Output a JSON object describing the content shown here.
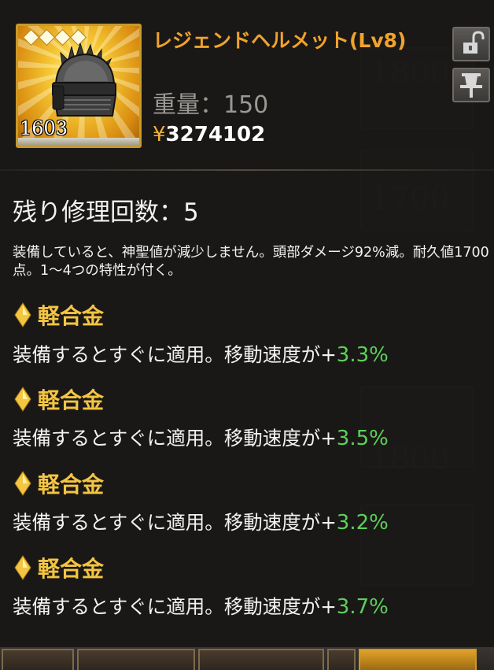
{
  "item": {
    "name": "レジェンドヘルメット(Lv8)",
    "count": "1603",
    "weight": "重量：150",
    "price_symbol": "¥",
    "price": "3274102",
    "stars": 4,
    "icon": "helmet-icon",
    "rarity_color": "#f0a32c"
  },
  "buttons": {
    "lock_icon": "unlock-icon",
    "pin_icon": "pin-icon"
  },
  "repair": {
    "label": "残り修理回数：5"
  },
  "description": "装備していると、神聖値が減少しません。頭部ダメージ92%減。耐久値1700点。1〜4つの特性が付く。",
  "traits": [
    {
      "name": "軽合金",
      "text": "装備するとすぐに適用。移動速度が+",
      "value": "3.3%"
    },
    {
      "name": "軽合金",
      "text": "装備するとすぐに適用。移動速度が+",
      "value": "3.5%"
    },
    {
      "name": "軽合金",
      "text": "装備するとすぐに適用。移動速度が+",
      "value": "3.2%"
    },
    {
      "name": "軽合金",
      "text": "装備するとすぐに適用。移動速度が+",
      "value": "3.7%"
    }
  ],
  "background": {
    "numbers": [
      "1800",
      "1700",
      "1800"
    ]
  },
  "colors": {
    "trait_title": "#f4c542",
    "trait_value": "#5dd05a",
    "frame": "#c79a2a"
  }
}
